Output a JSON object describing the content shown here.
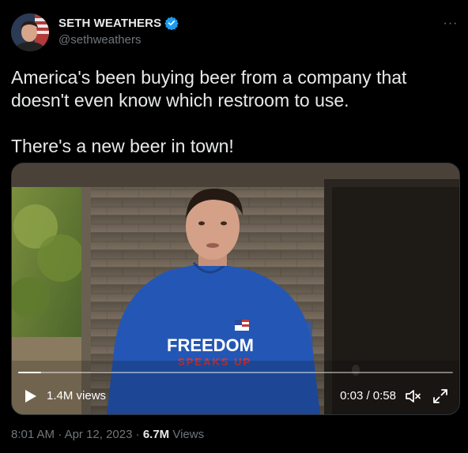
{
  "author": {
    "name": "SETH WEATHERS",
    "handle": "@sethweathers",
    "verified_icon": "verified-badge-icon",
    "verified_color": "#1d9bf0"
  },
  "more_label": "···",
  "tweet": {
    "text_line1": "America's been buying beer from a company that doesn't even know which restroom to use.",
    "text_line2": "There's a new beer in town!"
  },
  "video": {
    "shirt_text_1": "FREEDOM",
    "shirt_text_2": "SPEAKS UP",
    "views": "1.4M views",
    "time": "0:03 / 0:58",
    "progress": 0.052,
    "play_icon": "play-icon",
    "mute_icon": "muted-speaker-icon",
    "fullscreen_icon": "expand-icon"
  },
  "meta": {
    "time": "8:01 AM",
    "sep1": "·",
    "date": "Apr 12, 2023",
    "sep2": "·",
    "view_count": "6.7M",
    "views_label": "Views"
  },
  "colors": {
    "background": "#000000",
    "text_primary": "#e7e9ea",
    "text_secondary": "#71767b",
    "hoodie_blue": "#2457b5"
  }
}
